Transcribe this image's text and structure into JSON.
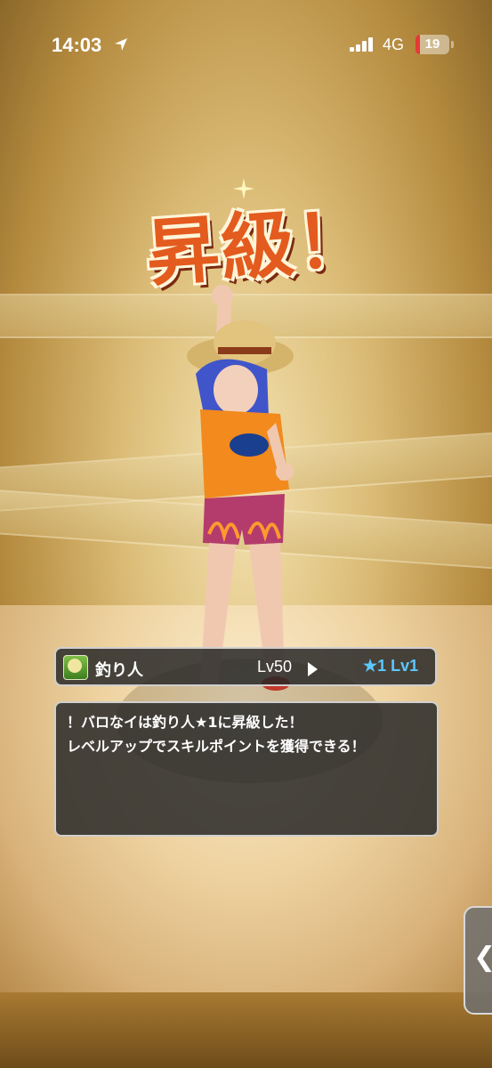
{
  "status_bar": {
    "time": "14:03",
    "network": "4G",
    "battery": "19",
    "icons": [
      "location-arrow-icon",
      "signal-bars-icon",
      "battery-icon"
    ]
  },
  "title": "昇級！",
  "job": {
    "name": "釣り人",
    "level_label": "Lv50",
    "rank_label": "★1 Lv1"
  },
  "message": {
    "lines": [
      "！バロなイは釣り人★1に昇級した！",
      "レベルアップでスキルポイントを獲得できる！"
    ]
  },
  "side_handle": {
    "glyph": "❮"
  },
  "colors": {
    "title": "#e35b1e",
    "rank": "#5cc8ff",
    "panel": "#282828"
  }
}
